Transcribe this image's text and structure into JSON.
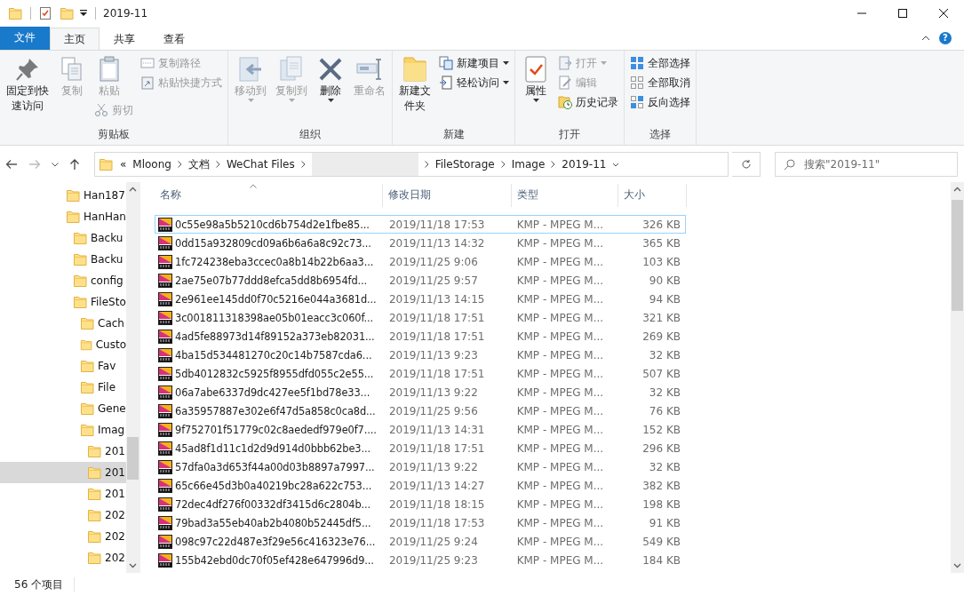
{
  "window": {
    "title": "2019-11"
  },
  "tabs": [
    {
      "label": "文件",
      "kind": "file",
      "selected": false
    },
    {
      "label": "主页",
      "kind": "tab",
      "selected": true
    },
    {
      "label": "共享",
      "kind": "tab",
      "selected": false
    },
    {
      "label": "查看",
      "kind": "tab",
      "selected": false
    }
  ],
  "help_button": "?",
  "ribbon": [
    {
      "label": "剪贴板",
      "columns": [
        [
          {
            "kind": "large",
            "label": "固定到快速访问",
            "disabled": false,
            "dropdown": false
          }
        ],
        [
          {
            "kind": "large",
            "label": "复制",
            "disabled": true,
            "dropdown": false
          }
        ],
        [
          {
            "kind": "large",
            "label": "粘贴",
            "disabled": true,
            "dropdown": false
          },
          {
            "kind": "small",
            "label": "剪切",
            "disabled": true,
            "dropdown": false
          }
        ],
        [
          {
            "kind": "small",
            "label": "复制路径",
            "disabled": true,
            "dropdown": false
          },
          {
            "kind": "small",
            "label": "粘贴快捷方式",
            "disabled": true,
            "dropdown": false
          }
        ]
      ]
    },
    {
      "label": "组织",
      "columns": [
        [
          {
            "kind": "large",
            "label": "移动到",
            "disabled": true,
            "dropdown": true
          }
        ],
        [
          {
            "kind": "large",
            "label": "复制到",
            "disabled": true,
            "dropdown": true
          }
        ],
        [
          {
            "kind": "large",
            "label": "删除",
            "disabled": false,
            "dropdown": true
          }
        ],
        [
          {
            "kind": "large",
            "label": "重命名",
            "disabled": true,
            "dropdown": false
          }
        ]
      ]
    },
    {
      "label": "新建",
      "columns": [
        [
          {
            "kind": "large",
            "label": "新建文件夹",
            "disabled": false,
            "dropdown": false
          }
        ],
        [
          {
            "kind": "small",
            "label": "新建项目",
            "disabled": false,
            "dropdown": true
          },
          {
            "kind": "small",
            "label": "轻松访问",
            "disabled": false,
            "dropdown": true
          }
        ]
      ]
    },
    {
      "label": "打开",
      "columns": [
        [
          {
            "kind": "large",
            "label": "属性",
            "disabled": false,
            "dropdown": true
          }
        ],
        [
          {
            "kind": "small",
            "label": "打开",
            "disabled": true,
            "dropdown": true
          },
          {
            "kind": "small",
            "label": "编辑",
            "disabled": true,
            "dropdown": false
          },
          {
            "kind": "small",
            "label": "历史记录",
            "disabled": false,
            "dropdown": false
          }
        ]
      ]
    },
    {
      "label": "选择",
      "columns": [
        [
          {
            "kind": "small",
            "label": "全部选择",
            "disabled": false,
            "dropdown": false
          },
          {
            "kind": "small",
            "label": "全部取消",
            "disabled": false,
            "dropdown": false
          },
          {
            "kind": "small",
            "label": "反向选择",
            "disabled": false,
            "dropdown": false
          }
        ]
      ]
    }
  ],
  "address": {
    "overflow": "«",
    "segments": [
      {
        "kind": "folder",
        "label": "Mloong"
      },
      {
        "kind": "folder",
        "label": "文档"
      },
      {
        "kind": "folder",
        "label": "WeChat Files"
      },
      {
        "kind": "redacted"
      },
      {
        "kind": "folder",
        "label": "FileStorage"
      },
      {
        "kind": "folder",
        "label": "Image"
      },
      {
        "kind": "folder",
        "label": "2019-11"
      }
    ]
  },
  "search": {
    "placeholder": "搜索\"2019-11\""
  },
  "tree": [
    {
      "label": "Han187",
      "selected": false
    },
    {
      "label": "HanHan",
      "selected": false,
      "children": [
        {
          "label": "Backu",
          "selected": false
        },
        {
          "label": "Backu",
          "selected": false
        },
        {
          "label": "config",
          "selected": false
        },
        {
          "label": "FileSto",
          "selected": false,
          "children": [
            {
              "label": "Cach",
              "selected": false
            },
            {
              "label": "Custo",
              "selected": false
            },
            {
              "label": "Fav",
              "selected": false
            },
            {
              "label": "File",
              "selected": false
            },
            {
              "label": "Gene",
              "selected": false
            },
            {
              "label": "Imag",
              "selected": false,
              "children": [
                {
                  "label": "201",
                  "selected": false
                },
                {
                  "label": "201",
                  "selected": true
                },
                {
                  "label": "201",
                  "selected": false
                },
                {
                  "label": "202",
                  "selected": false
                },
                {
                  "label": "202",
                  "selected": false
                },
                {
                  "label": "202",
                  "selected": false
                }
              ]
            }
          ]
        }
      ]
    }
  ],
  "table": {
    "columns": [
      "名称",
      "修改日期",
      "类型",
      "大小"
    ],
    "rows": [
      {
        "name": "0c55e98a5b5210cd6b754d2e1fbe85...",
        "date": "2019/11/18 17:53",
        "type": "KMP - MPEG M...",
        "size": "326 KB",
        "focused": true
      },
      {
        "name": "0dd15a932809cd09a6b6a6a8c92c73...",
        "date": "2019/11/13 14:32",
        "type": "KMP - MPEG M...",
        "size": "365 KB",
        "focused": false
      },
      {
        "name": "1fc724238eba3ccec0a8b14b22b6aa3...",
        "date": "2019/11/25 9:06",
        "type": "KMP - MPEG M...",
        "size": "103 KB",
        "focused": false
      },
      {
        "name": "2ae75e07b77ddd8efca5dd8b6954fd...",
        "date": "2019/11/25 9:57",
        "type": "KMP - MPEG M...",
        "size": "90 KB",
        "focused": false
      },
      {
        "name": "2e961ee145dd0f70c5216e044a3681d...",
        "date": "2019/11/13 14:15",
        "type": "KMP - MPEG M...",
        "size": "94 KB",
        "focused": false
      },
      {
        "name": "3c001811318398ae05b01eacc3c060f...",
        "date": "2019/11/18 17:51",
        "type": "KMP - MPEG M...",
        "size": "321 KB",
        "focused": false
      },
      {
        "name": "4ad5fe88973d14f89152a373eb82031...",
        "date": "2019/11/18 17:51",
        "type": "KMP - MPEG M...",
        "size": "269 KB",
        "focused": false
      },
      {
        "name": "4ba15d534481270c20c14b7587cda6...",
        "date": "2019/11/13 9:23",
        "type": "KMP - MPEG M...",
        "size": "32 KB",
        "focused": false
      },
      {
        "name": "5db4012832c5925f8955dfd055c2e55...",
        "date": "2019/11/18 17:51",
        "type": "KMP - MPEG M...",
        "size": "507 KB",
        "focused": false
      },
      {
        "name": "06a7abe6337d9dc427ee5f1bd78e33...",
        "date": "2019/11/13 9:22",
        "type": "KMP - MPEG M...",
        "size": "32 KB",
        "focused": false
      },
      {
        "name": "6a35957887e302e6f47d5a858c0ca8d...",
        "date": "2019/11/25 9:56",
        "type": "KMP - MPEG M...",
        "size": "76 KB",
        "focused": false
      },
      {
        "name": "9f752701f51779c02c8aededf979e0f7....",
        "date": "2019/11/13 14:31",
        "type": "KMP - MPEG M...",
        "size": "152 KB",
        "focused": false
      },
      {
        "name": "45ad8f1d11c1d2d9d914d0bbb62be3...",
        "date": "2019/11/18 17:51",
        "type": "KMP - MPEG M...",
        "size": "296 KB",
        "focused": false
      },
      {
        "name": "57dfa0a3d653f44a00d03b8897a7997...",
        "date": "2019/11/13 9:22",
        "type": "KMP - MPEG M...",
        "size": "32 KB",
        "focused": false
      },
      {
        "name": "65c66e45d3b0a40219bc28a622c753...",
        "date": "2019/11/13 14:27",
        "type": "KMP - MPEG M...",
        "size": "382 KB",
        "focused": false
      },
      {
        "name": "72dec4df276f00332df3415d6c2804b...",
        "date": "2019/11/18 18:15",
        "type": "KMP - MPEG M...",
        "size": "198 KB",
        "focused": false
      },
      {
        "name": "79bad3a55eb40ab2b4080b52445df5...",
        "date": "2019/11/18 17:53",
        "type": "KMP - MPEG M...",
        "size": "91 KB",
        "focused": false
      },
      {
        "name": "098c97c22d487e3f29e56c416323e76...",
        "date": "2019/11/25 9:24",
        "type": "KMP - MPEG M...",
        "size": "549 KB",
        "focused": false
      },
      {
        "name": "155b42ebd0dc70f05ef428e647996d9...",
        "date": "2019/11/25 9:23",
        "type": "KMP - MPEG M...",
        "size": "184 KB",
        "focused": false
      }
    ]
  },
  "status_bar": {
    "count": "56 个项目"
  }
}
